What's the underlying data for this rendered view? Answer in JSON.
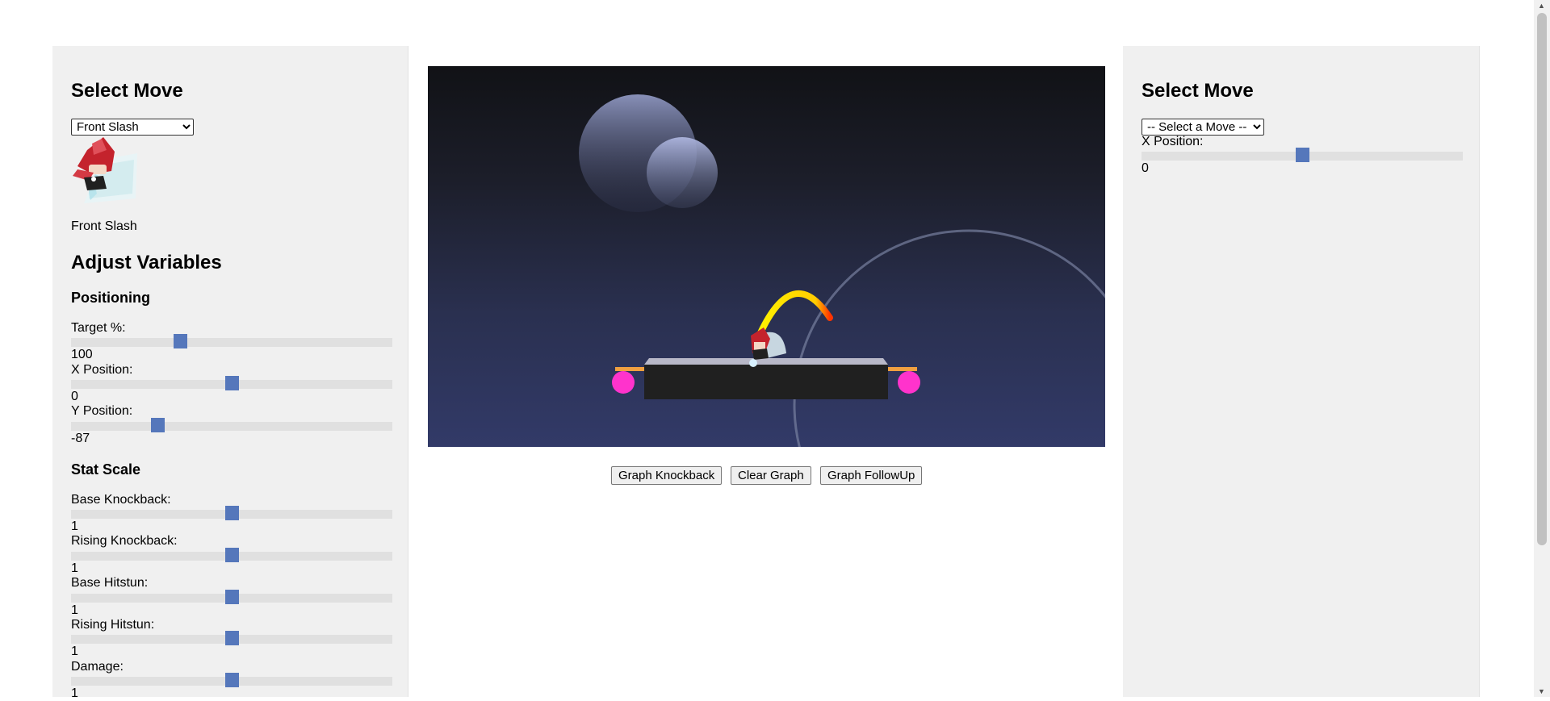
{
  "left": {
    "select_move_heading": "Select Move",
    "move_select_value": "Front Slash",
    "move_name": "Front Slash",
    "adjust_heading": "Adjust Variables",
    "positioning_heading": "Positioning",
    "target_label": "Target %:",
    "target_value": "100",
    "target_fraction": 0.34,
    "xpos_label": "X Position:",
    "xpos_value": "0",
    "xpos_fraction": 0.5,
    "ypos_label": "Y Position:",
    "ypos_value": "-87",
    "ypos_fraction": 0.27,
    "stat_heading": "Stat Scale",
    "stats": [
      {
        "label": "Base Knockback:",
        "value": "1",
        "fraction": 0.5
      },
      {
        "label": "Rising Knockback:",
        "value": "1",
        "fraction": 0.5
      },
      {
        "label": "Base Hitstun:",
        "value": "1",
        "fraction": 0.5
      },
      {
        "label": "Rising Hitstun:",
        "value": "1",
        "fraction": 0.5
      },
      {
        "label": "Damage:",
        "value": "1",
        "fraction": 0.5
      }
    ]
  },
  "right": {
    "select_move_heading": "Select Move",
    "move_select_value": "-- Select a Move --",
    "xpos_label": "X Position:",
    "xpos_value": "0",
    "xpos_fraction": 0.5
  },
  "buttons": {
    "graph_knockback": "Graph Knockback",
    "clear_graph": "Clear Graph",
    "graph_followup": "Graph FollowUp"
  },
  "colors": {
    "slider_thumb": "#5577bb",
    "stage_accent": "#ff33cc",
    "arc": "#ffee00"
  }
}
